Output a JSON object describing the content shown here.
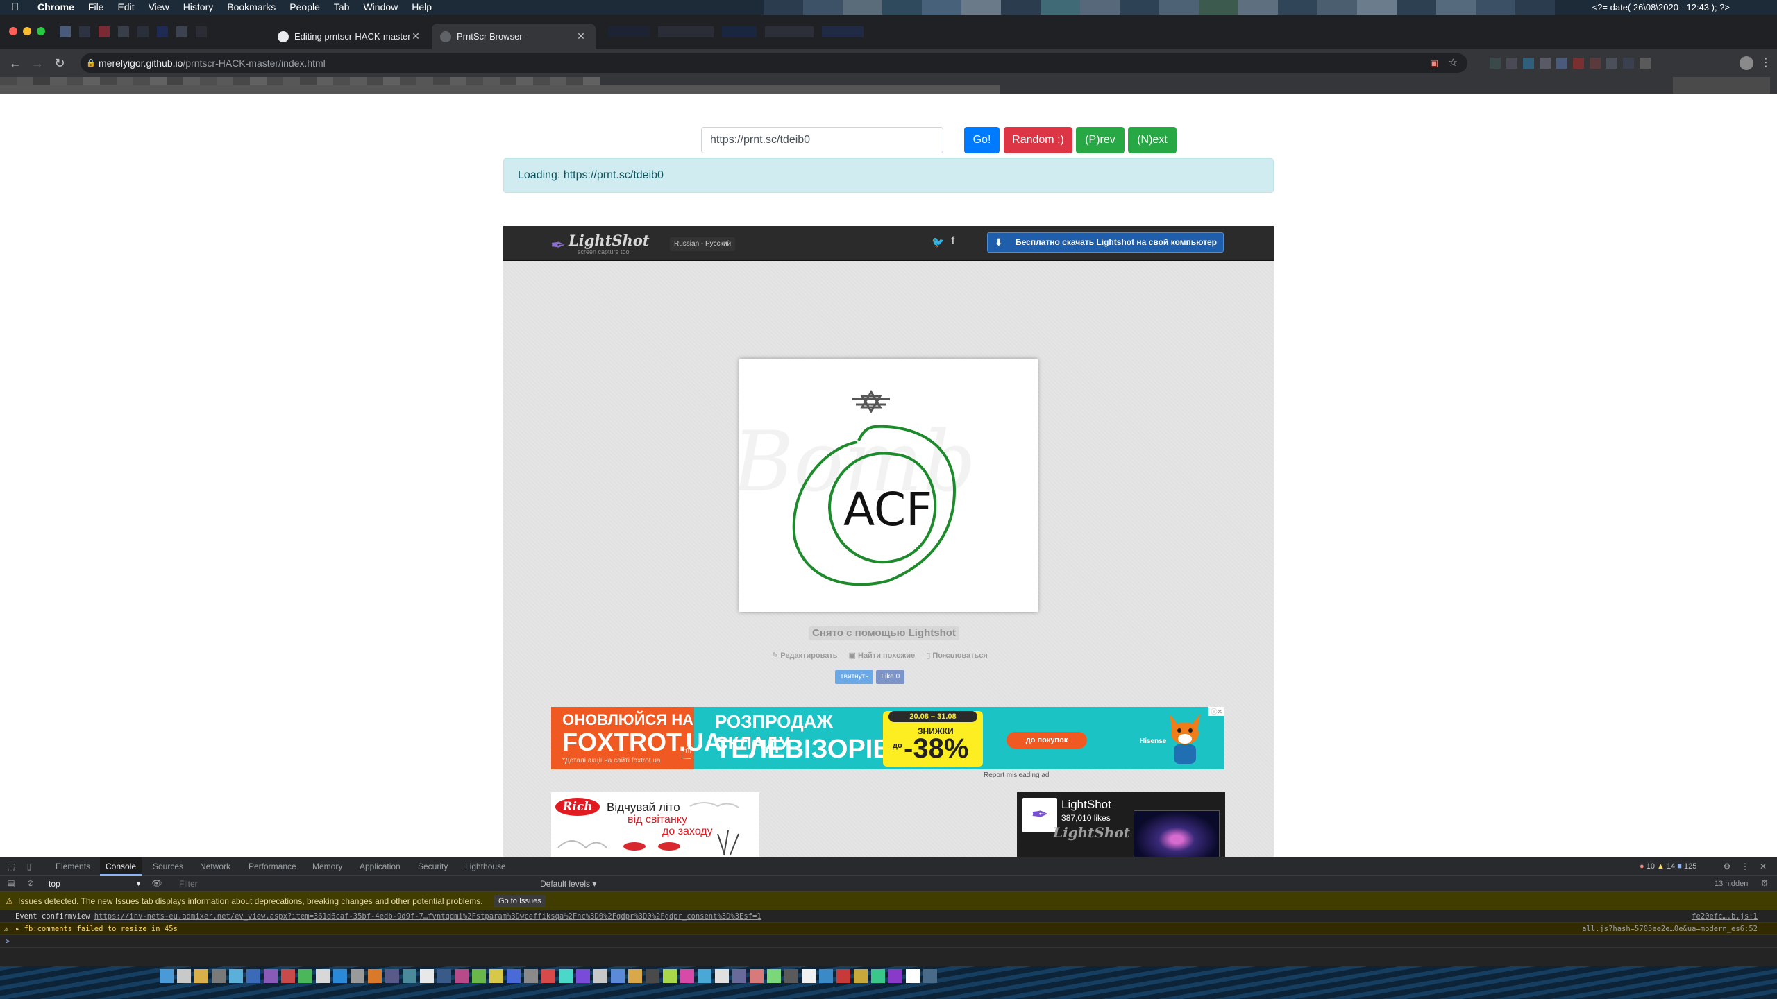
{
  "os": {
    "menu": [
      "Chrome",
      "File",
      "Edit",
      "View",
      "History",
      "Bookmarks",
      "People",
      "Tab",
      "Window",
      "Help"
    ],
    "status_text": "<?= date( 26\\08\\2020 - 12:43 ); ?>"
  },
  "browser": {
    "tabs": [
      {
        "title": "Editing prntscr-HACK-master/i",
        "active": false
      },
      {
        "title": "PrntScr Browser",
        "active": true
      }
    ],
    "url_host": "merelyigor.github.io",
    "url_path": "/prntscr-HACK-master/index.html"
  },
  "page": {
    "url_value": "https://prnt.sc/tdeib0",
    "buttons": {
      "go": "Go!",
      "random": "Random :)",
      "prev": "(P)rev",
      "next": "(N)ext"
    },
    "alert": "Loading: https://prnt.sc/tdeib0"
  },
  "lightshot": {
    "logo": "LightShot",
    "logo_sub": "screen capture tool",
    "language": "Russian - Русский",
    "download": "Бесплатно скачать Lightshot на свой компьютер",
    "screenshot_text": "ACF",
    "caption": "Снято с помощью Lightshot",
    "actions": [
      "Редактировать",
      "Найти похожие",
      "Пожаловаться"
    ],
    "tweet": "Твитнуть",
    "like": "Like 0"
  },
  "ads": {
    "foxtrot": {
      "line1": "ОНОВЛЮЙСЯ НА",
      "line2": "FOXTROT.UA",
      "line3": "*Деталі акції на сайті foxtrot.ua",
      "headline1": "РОЗПРОДАЖ СКЛАДУ",
      "headline2": "ТЕЛЕВІЗОРІВ",
      "dates": "20.08 – 31.08",
      "discount_word": "ЗНИЖКИ",
      "discount_prefix": "до",
      "discount": "-38%",
      "cta": "до покупок",
      "brand": "Hisense"
    },
    "report": "Report misleading ad",
    "rich": {
      "logo": "Rich",
      "line1": "Відчувай літо",
      "line2": "від світанку",
      "line3": "до заходу"
    },
    "fbpage": {
      "name": "LightShot",
      "likes": "387,010 likes",
      "watermark": "LightShot"
    }
  },
  "devtools": {
    "tabs": [
      "Elements",
      "Console",
      "Sources",
      "Network",
      "Performance",
      "Memory",
      "Application",
      "Security",
      "Lighthouse"
    ],
    "counts": {
      "errors": "10",
      "warnings": "14",
      "info": "125"
    },
    "context": "top",
    "filter_placeholder": "Filter",
    "levels": "Default levels ▾",
    "hidden": "13 hidden",
    "issues_text": "Issues detected. The new Issues tab displays information about deprecations, breaking changes and other potential problems.",
    "go_to_issues": "Go to Issues",
    "log1_prefix": "Event confirmview ",
    "log1_link": "https://inv-nets-eu.admixer.net/ev_view.aspx?item=361d6caf-35bf-4edb-9d9f-7…fvntqdmi%2Fstparam%3Dwceffiksqa%2Fnc%3D0%2Fgdpr%3D0%2Fgdpr_consent%3D%3Esf=1",
    "log1_src": "fe20efc….b.js:1",
    "log2_text": "▸ fb:comments failed to resize in 45s",
    "log2_src": "all.js?hash=5705ee2e…0e&ua=modern_es6:52",
    "prompt": ">"
  },
  "colors": {
    "go": "#007bff",
    "random": "#dc3545",
    "green": "#28a745",
    "alert_bg": "#d1ecf1",
    "alert_text": "#0c5460",
    "ad_teal": "#1cc3c4",
    "ad_orange": "#f05a22",
    "ad_yellow": "#fcee21",
    "stroke_green": "#1d8a2c"
  }
}
